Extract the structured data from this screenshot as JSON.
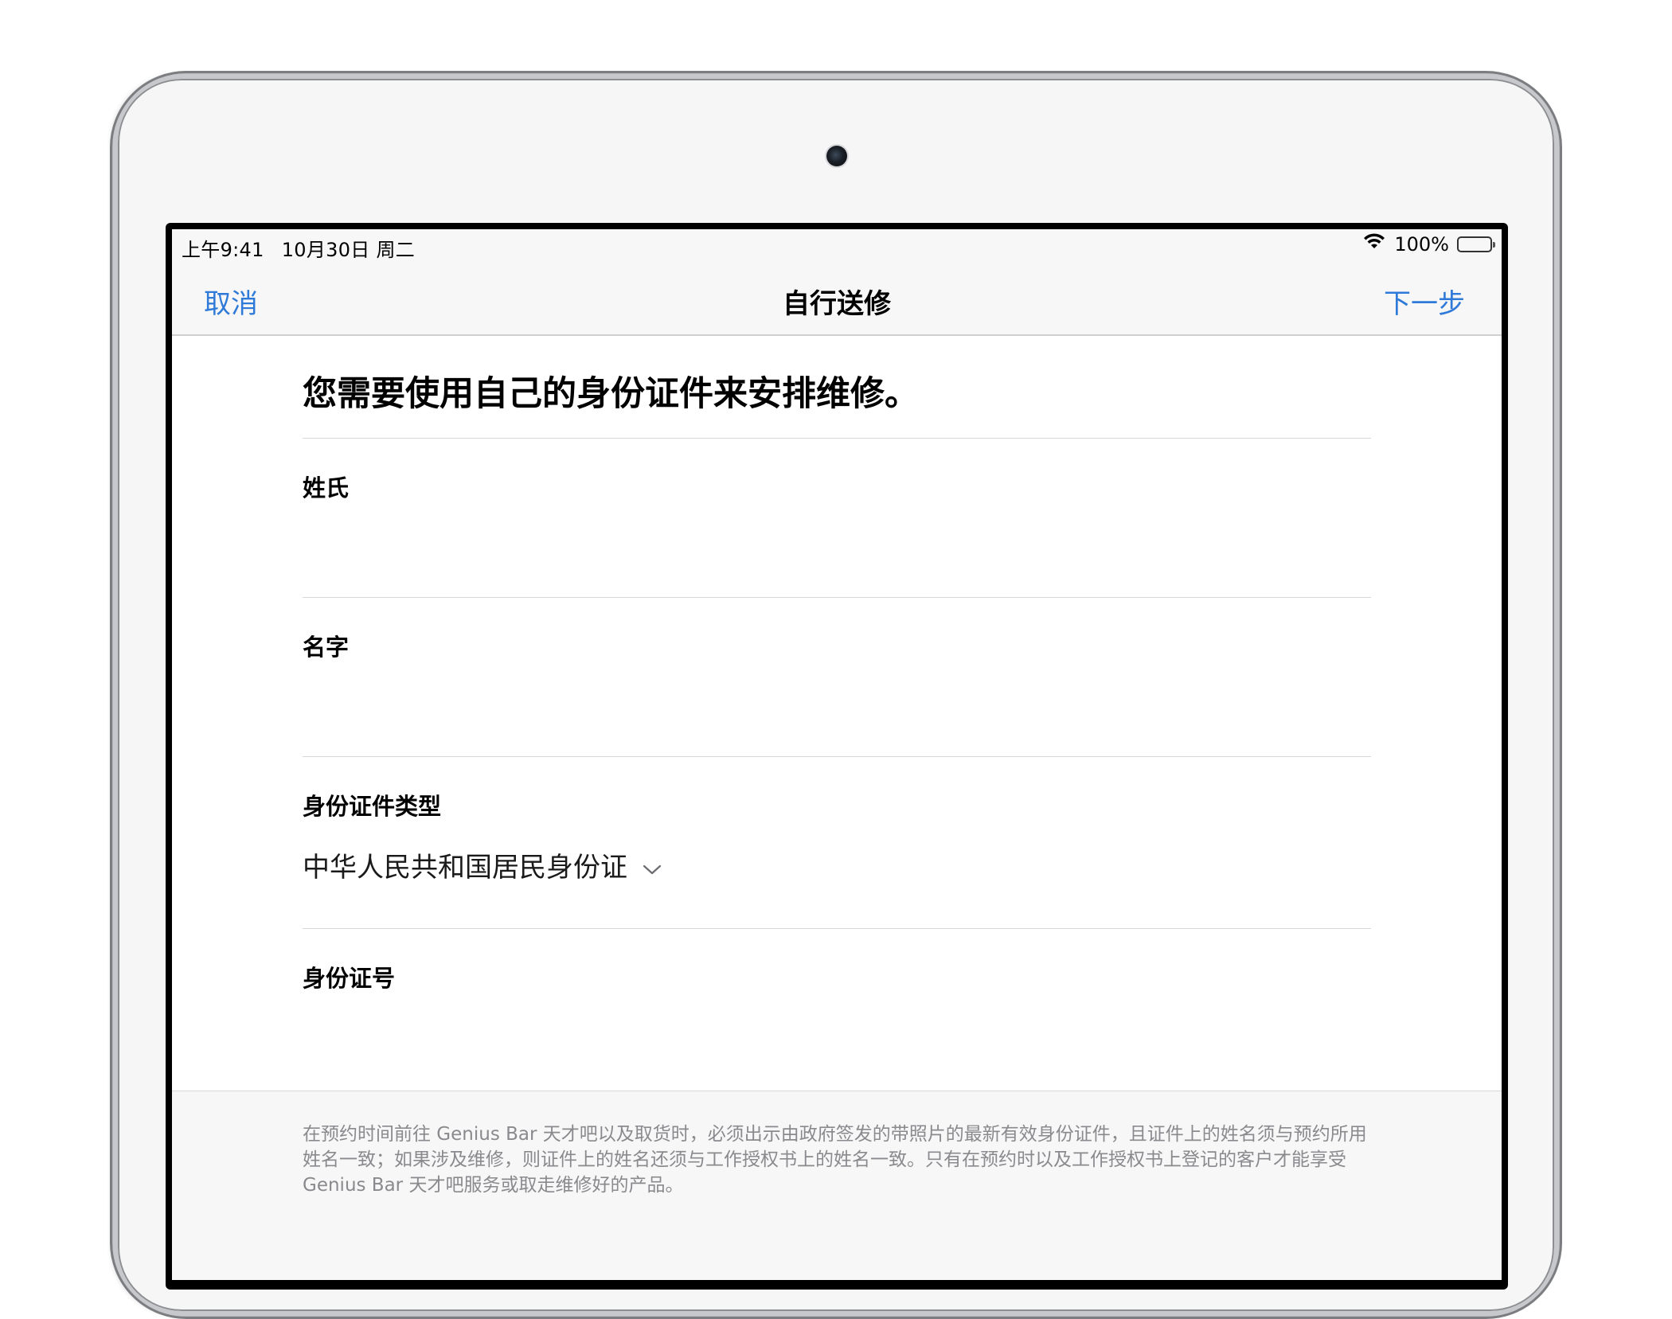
{
  "status_bar": {
    "time": "上午9:41",
    "date": "10月30日 周二",
    "battery_percent": "100%",
    "battery_level": 1.0
  },
  "nav": {
    "cancel_label": "取消",
    "title": "自行送修",
    "next_label": "下一步"
  },
  "form": {
    "heading": "您需要使用自己的身份证件来安排维修。",
    "last_name": {
      "label": "姓氏",
      "value": ""
    },
    "first_name": {
      "label": "名字",
      "value": ""
    },
    "id_type": {
      "label": "身份证件类型",
      "selected": "中华人民共和国居民身份证"
    },
    "id_number": {
      "label": "身份证号",
      "value": ""
    }
  },
  "footnote": "在预约时间前往 Genius Bar 天才吧以及取货时，必须出示由政府签发的带照片的最新有效身份证件，且证件上的姓名须与预约所用姓名一致；如果涉及维修，则证件上的姓名还须与工作授权书上的姓名一致。只有在预约时以及工作授权书上登记的客户才能享受 Genius Bar 天才吧服务或取走维修好的产品。",
  "colors": {
    "accent": "#2f7ad8",
    "bar_background": "#f7f7f7",
    "footnote_text": "#8a8a8e"
  },
  "icons": {
    "wifi": "wifi-icon",
    "battery": "battery-icon",
    "chevron": "chevron-down-icon",
    "camera": "camera-icon"
  }
}
